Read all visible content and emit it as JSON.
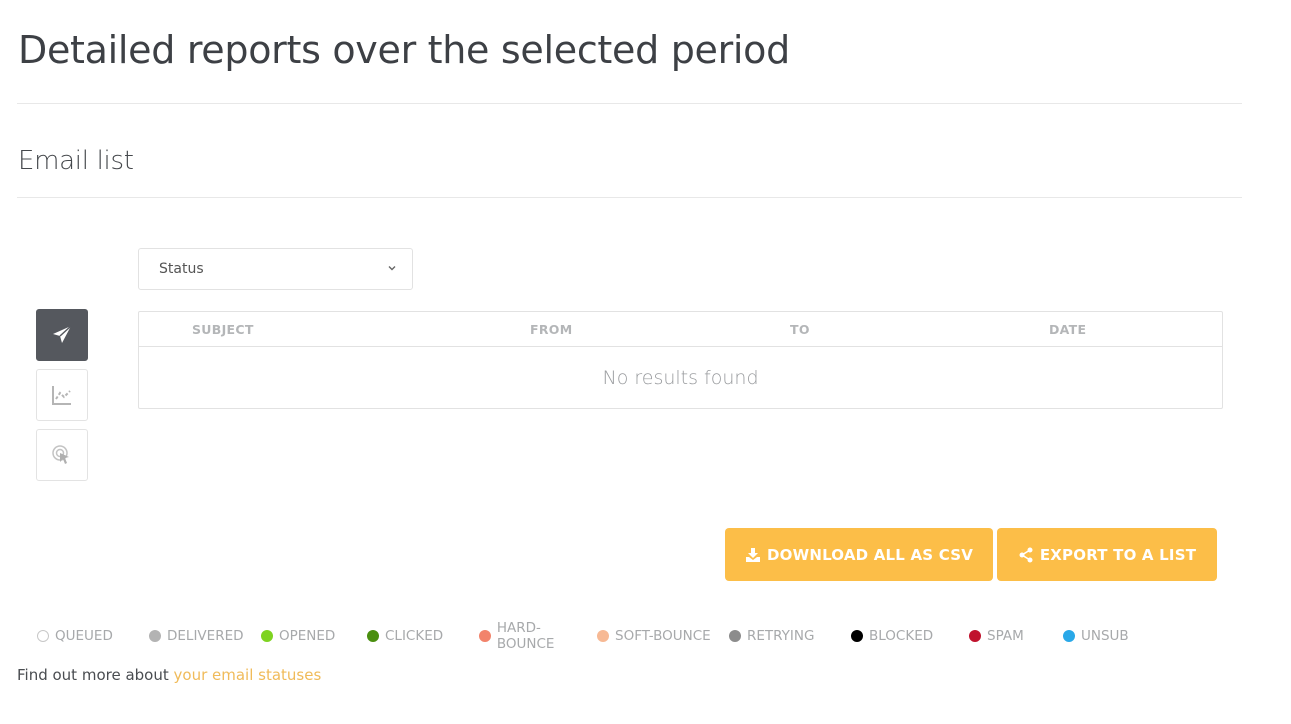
{
  "header": {
    "title": "Detailed reports over the selected period"
  },
  "section": {
    "title": "Email list"
  },
  "filter": {
    "status_select": {
      "selected": "Status"
    }
  },
  "side_tabs": [
    {
      "name": "sent",
      "icon": "paper-plane-icon",
      "active": true
    },
    {
      "name": "stats",
      "icon": "chart-line-icon",
      "active": false
    },
    {
      "name": "clicks",
      "icon": "click-pointer-icon",
      "active": false
    }
  ],
  "table": {
    "columns": [
      "SUBJECT",
      "FROM",
      "TO",
      "DATE"
    ],
    "rows": [],
    "empty_message": "No results found"
  },
  "actions": {
    "download_csv": {
      "label": "DOWNLOAD ALL AS CSV",
      "icon": "download-icon"
    },
    "export_list": {
      "label": "EXPORT TO A LIST",
      "icon": "share-icon"
    }
  },
  "legend": [
    {
      "label": "QUEUED",
      "color": "#ffffff",
      "hollow": true
    },
    {
      "label": "DELIVERED",
      "color": "#b3b3b3"
    },
    {
      "label": "OPENED",
      "color": "#7ed321"
    },
    {
      "label": "CLICKED",
      "color": "#4a8f0f"
    },
    {
      "label": "HARD-BOUNCE",
      "color": "#f2836b"
    },
    {
      "label": "SOFT-BOUNCE",
      "color": "#f7b994"
    },
    {
      "label": "RETRYING",
      "color": "#8c8c8c"
    },
    {
      "label": "BLOCKED",
      "color": "#000000"
    },
    {
      "label": "SPAM",
      "color": "#c0122d"
    },
    {
      "label": "UNSUB",
      "color": "#29a8e8"
    }
  ],
  "footer": {
    "text": "Find out more about ",
    "link_label": "your email statuses"
  },
  "colors": {
    "accent": "#fcbe48",
    "active_tab": "#55585e",
    "link": "#f0bb5a"
  }
}
